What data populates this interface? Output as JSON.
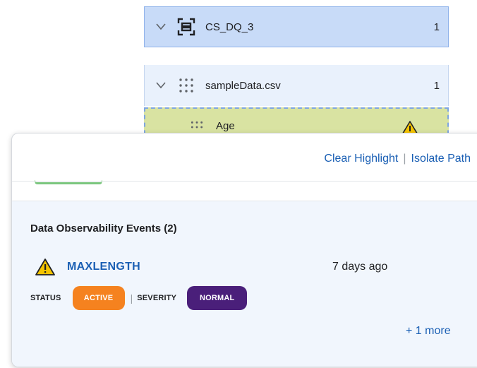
{
  "tree": {
    "dataset": {
      "label": "CS_DQ_3",
      "count": "1",
      "icon": "dataset-icon"
    },
    "file": {
      "label": "sampleData.csv",
      "count": "1",
      "icon": "grid-dots-icon"
    },
    "field": {
      "label": "Age",
      "icon": "grid-dots-icon",
      "status_icon": "warning-icon"
    }
  },
  "panel": {
    "header": {
      "clear_highlight": "Clear Highlight",
      "separator": "|",
      "isolate_path": "Isolate Path"
    },
    "events": {
      "title": "Data Observability Events (2)",
      "items": [
        {
          "name": "MAXLENGTH",
          "time": "7 days ago",
          "status_label": "STATUS",
          "status": "ACTIVE",
          "separator": "|",
          "severity_label": "SEVERITY",
          "severity": "NORMAL"
        }
      ],
      "more": "+ 1 more"
    }
  },
  "colors": {
    "link": "#1a5fb4",
    "active_badge": "#f5821f",
    "normal_badge": "#4a1f7a",
    "warning": "#f5c400",
    "selected_node": "#c8dbf8",
    "highlighted_field": "#d9e3a2"
  }
}
